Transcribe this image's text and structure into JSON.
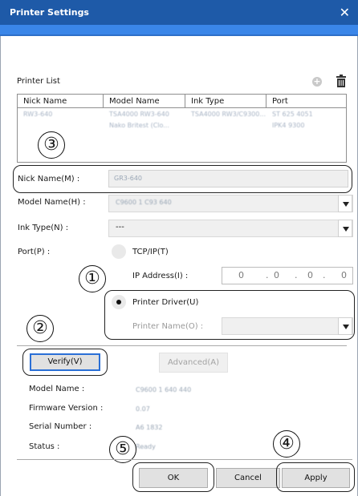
{
  "window": {
    "title": "Printer Settings",
    "close_glyph": "✕"
  },
  "printer_list": {
    "label": "Printer List",
    "columns": [
      "Nick Name",
      "Model Name",
      "Ink Type",
      "Port"
    ],
    "rows": [
      [
        "RW3-640",
        "TSA4000 RW3-640",
        "TSA4000 RW3/C9300...",
        "ST 625 4051"
      ],
      [
        "",
        "Nako Britest (Clo...",
        "",
        "IPK4 9300"
      ]
    ],
    "add_icon": "add-icon",
    "delete_icon": "trash-icon"
  },
  "callouts": [
    "③",
    "①",
    "②",
    "⑤",
    "④"
  ],
  "form": {
    "nick_name_label": "Nick Name(M) :",
    "nick_name_value": "GR3-640",
    "model_name_label": "Model Name(H) :",
    "model_name_value": "C9600 1 C93 640",
    "ink_type_label": "Ink Type(N) :",
    "ink_type_value": "---",
    "port_label": "Port(P) :",
    "tcpip_label": "TCP/IP(T)",
    "ip_address_label": "IP Address(I) :",
    "ip_address": [
      "0",
      "0",
      "0",
      "0"
    ],
    "printer_driver_label": "Printer Driver(U)",
    "printer_name_label": "Printer Name(O) :",
    "printer_name_value": ""
  },
  "verify": {
    "verify_label": "Verify(V)",
    "advanced_label": "Advanced(A)",
    "model_name_label": "Model Name :",
    "model_name_value": "C9600 1 640 440",
    "firmware_label": "Firmware Version :",
    "firmware_value": "0.07",
    "serial_label": "Serial Number :",
    "serial_value": "A6 1832",
    "status_label": "Status :",
    "status_value": "Ready"
  },
  "buttons": {
    "ok": "OK",
    "cancel": "Cancel",
    "apply": "Apply"
  }
}
